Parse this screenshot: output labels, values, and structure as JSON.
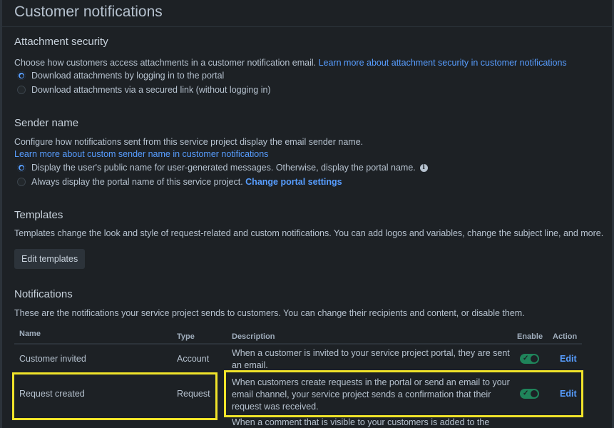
{
  "page": {
    "title": "Customer notifications"
  },
  "attachment_security": {
    "heading": "Attachment security",
    "description": "Choose how customers access attachments in a customer notification email.",
    "learn_more": "Learn more about attachment security in customer notifications",
    "options": [
      {
        "label": "Download attachments by logging in to the portal",
        "selected": true
      },
      {
        "label": "Download attachments via a secured link (without logging in)",
        "selected": false
      }
    ]
  },
  "sender_name": {
    "heading": "Sender name",
    "description": "Configure how notifications sent from this service project display the email sender name.",
    "learn_more": "Learn more about custom sender name in customer notifications",
    "options": [
      {
        "label": "Display the user's public name for user-generated messages. Otherwise, display the portal name.",
        "selected": true
      },
      {
        "label": "Always display the portal name of this service project.",
        "selected": false
      }
    ],
    "change_link": "Change portal settings",
    "info_icon": "info-icon"
  },
  "templates": {
    "heading": "Templates",
    "description": "Templates change the look and style of request-related and custom notifications. You can add logos and variables, change the subject line, and more.",
    "button": "Edit templates"
  },
  "notifications": {
    "heading": "Notifications",
    "description": "These are the notifications your service project sends to customers. You can change their recipients and content, or disable them.",
    "columns": {
      "name": "Name",
      "type": "Type",
      "description": "Description",
      "enable": "Enable",
      "action": "Action"
    },
    "rows": [
      {
        "name": "Customer invited",
        "type": "Account",
        "description": "When a customer is invited to your service project portal, they are sent an email.",
        "enabled": true,
        "action": "Edit"
      },
      {
        "name": "Request created",
        "type": "Request",
        "description": "When customers create requests in the portal or send an email to your email channel, your service project sends a confirmation that their request was received.",
        "enabled": true,
        "action": "Edit"
      },
      {
        "name": "",
        "type": "",
        "description": "When a comment that is visible to your customers is added to the",
        "enabled": true,
        "action": ""
      }
    ]
  },
  "colors": {
    "background": "#1d2125",
    "link": "#579dff",
    "toggle_on": "#1f845a",
    "highlight": "#f0e32a"
  }
}
